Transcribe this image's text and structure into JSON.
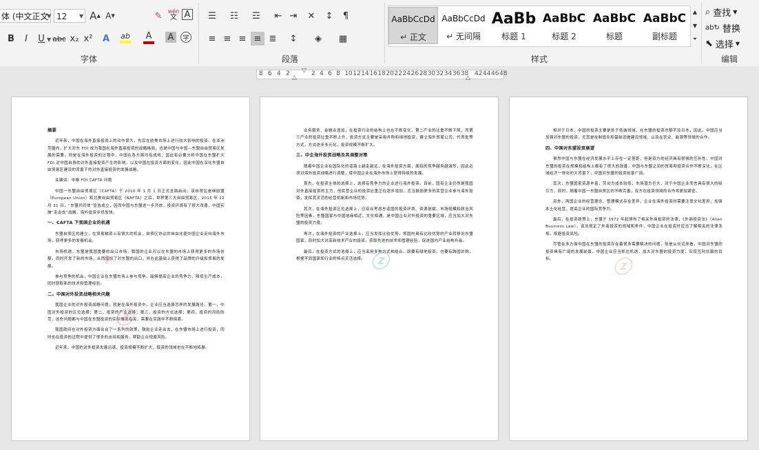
{
  "ribbon": {
    "font": {
      "name": "体 (中文正文",
      "size": "12",
      "group_label": "字体",
      "grow": "A",
      "shrink": "A",
      "phonetic_main": "wén",
      "phonetic_sub": "文",
      "border_char": "A",
      "bold": "B",
      "italic": "I",
      "underline": "U",
      "strike": "abc",
      "subscript": "x₂",
      "superscript": "x²",
      "effects": "A",
      "highlight_label": "ab",
      "font_color_label": "A",
      "char_shade": "A",
      "enclose": "字",
      "highlight_color": "#ffff00",
      "font_color": "#c00000"
    },
    "paragraph": {
      "group_label": "段落"
    },
    "styles": {
      "group_label": "样式",
      "items": [
        {
          "preview": "AaBbCcDd",
          "name": "↵ 正文"
        },
        {
          "preview": "AaBbCcDd",
          "name": "↵ 无间隔"
        },
        {
          "preview": "AaBb",
          "name": "标题 1"
        },
        {
          "preview": "AaBbC",
          "name": "标题 2"
        },
        {
          "preview": "AaBbC",
          "name": "标题"
        },
        {
          "preview": "AaBbC",
          "name": "副标题"
        }
      ]
    },
    "editing": {
      "group_label": "编辑",
      "find": "查找",
      "replace": "替换",
      "select": "选择"
    }
  },
  "ruler": {
    "left_numbers": [
      "8",
      "6",
      "4",
      "2"
    ],
    "numbers": [
      "2",
      "4",
      "6",
      "8",
      "10",
      "12",
      "14",
      "16",
      "18",
      "20",
      "22",
      "24",
      "26",
      "28",
      "30",
      "32",
      "34",
      "36",
      "38"
    ],
    "right_numbers": [
      "42",
      "44",
      "46",
      "48"
    ]
  },
  "pages": [
    {
      "blocks": [
        {
          "type": "head",
          "text": "摘要"
        },
        {
          "type": "para",
          "text": "近年来，中国在海外直接投资上的动作很大，先后在欧美市场上进行较大影响的投资。在亚洲范围内，扩大对东 FDI 成为我国在海外直接投资的战略格局，也是中国与中国—东盟自由贸易区发展的需要。但是在海外投资的过程中，中国在各方面均有成效，因此有必要分析中国在东盟扩大 FDI 对中国自身的对外直接投资产生的影响，以及中国在投资方面的变化，因此中国在深化东盟自由贸易区建设的背景下的对外直接投资的发展战略。"
        },
        {
          "type": "para",
          "text": "关键词：中泰  FDI  CAFTA  问题"
        },
        {
          "type": "para",
          "text": "中国一东盟自由贸易区（CAFTA）于 2010 年 1 月 1 日正式全面启动，该自贸区是继欧盟（European Union）和北美自由贸易区（NAFTA）之后，世界第三大自由贸易区。2015 年 12 月 31 日，“东盟共同体”宣告成立，因而中国与东盟进一步开放，投资环境有了很大改善，中国实施“走出去”战略，海外投资步伐加快。"
        },
        {
          "type": "head",
          "text": "一、CAFTA 下我国企业的机遇"
        },
        {
          "type": "para",
          "text": "东盟自贸区的建立，在贸易融资上有很大的机会，自贸区协议的自由化使中国企业走向海外市场，获得更多的发展机会。"
        },
        {
          "type": "para",
          "text": "市场机遇，东盟是我国重要的出口市场，我国的企业可以在东盟的市场上获得更多的市场份额，同时开发了新的市场，从而增加了对东盟的出口，并在此基础上获得了品牌的升级和贸易的发展。"
        },
        {
          "type": "para",
          "text": "参与竞争的机会，中国企业在东盟市场上参与竞争，能够提高企业的竞争力，降低生产成本，同时获取新的技术和管理经验。"
        },
        {
          "type": "head",
          "text": "二、中国对外投资战略相关问题"
        },
        {
          "type": "para",
          "text": "我国企业的对外投资战略问题，就是在海外投资中，企业应当选择怎样的发展路径。第一，中国对外投资的区位选择；第二，投资的产业选择；第三，投资的方式选择；第四，投资的风险防范，这些问题都与中国在东盟投资的实际情况有关，需要在实践中不断探索。"
        },
        {
          "type": "para",
          "text": "我国政府在对外投资方面出台了一系列的政策，鼓励企业走出去，在东盟市场上进行投资，同时也在投资的过程中提供了很多的支持和服务，帮助企业规避风险。"
        },
        {
          "type": "para",
          "text": "近年来，中国的对外投资发展迅速，投资规模不断扩大，投资的领域也在不断地拓展。"
        }
      ]
    },
    {
      "blocks": [
        {
          "type": "para",
          "text": "业务服务、金融业增加，在投资行业的结构上也在不断变化，第二产业的比重不断下降，而第三产业的投资比重不断上升，投资方式主要是采用并购和绿地投资，建立海外贸易公司、代表处等方式，方式逐步多元化，投资规模不断扩大。"
        },
        {
          "type": "head",
          "text": "三、中企海外投资战略及其调整对策"
        },
        {
          "type": "para",
          "text": "随着中国企业在国际化的道路上越走越远，在海外投资方面，面临的竞争越来越激烈，因此必须对海外投资战略进行调整，使中国企业在海外市场上获得持续的发展。"
        },
        {
          "type": "para",
          "text": "首先，在投资主体的选择上，选择有竞争力的企业进行海外投资。目前，国有企业仍然是我国对外直接投资的主力，但民营企业的投资比重正在逐步增加，应当鼓励更多的民营企业参与海外投资，发挥其灵活的经营机制和市场优势。"
        },
        {
          "type": "para",
          "text": "其次，在海外投资区位选择上，应综合考虑东道国的投资环境、资源禀赋、市场规模和政治风险等因素，东盟国家与中国地缘相近、文化相通，是中国企业对外投资的重要区域，应当加大对东盟的投资力度。"
        },
        {
          "type": "para",
          "text": "再次，在海外投资的产业选择上，应当发挥比较优势，将国内具有比较优势的产业转移到东盟国家，同时加大对高新技术产业的投资，获取先进的技术和管理经验，促进国内产业结构升级。"
        },
        {
          "type": "para",
          "text": "最后，在投资方式的选择上，应当采用多种方式相结合，既要有绿地投资，也要有跨国并购，根据不同国家和行业的特点灵活选择。"
        }
      ]
    },
    {
      "blocks": [
        {
          "type": "para",
          "text": "相对于日本，中国的投资主要是处于低端领域，在东盟的投资总额不及日本，因此，中国应当加强对东盟的投资，尤其是在制造业和基础设施建设领域，以及在农业、能源等领域的合作。"
        },
        {
          "type": "head",
          "text": "四、中国对东盟投资展望"
        },
        {
          "type": "para",
          "text": "虽然中国与东盟在经济发展水平上存在一定差距，但是双方的经济具有很强的互补性，中国对东盟的投资在规模和结构上都有了很大的改善，中国与东盟之间的贸易和投资合作不断深化，在区域经济一体化的大背景下，中国对东盟的投资前景广阔。"
        },
        {
          "type": "para",
          "text": "其次，东盟国家资源丰富，劳动力成本较低，市场潜力巨大，对于中国企业而言具有很大的吸引力，同时，随着中国一东盟自贸区的不断完善，双方在投资领域的合作将更加紧密。"
        },
        {
          "type": "para",
          "text": "另外，两国企业的经营理念、管理模式存在差异，企业在海外投资时需要注意文化差异，加强本土化经营，提高企业的国际竞争力。"
        },
        {
          "type": "para",
          "text": "最后，在投资政策上，东盟于 1972 年起颁布了相关外商投资的法律，《外商投资法》（Alien Business Law），该法规定了外商投资的领域和条件，中国企业在投资时应当了解相关的法律法规，规避投资风险。"
        },
        {
          "type": "para",
          "text": "尽管在多方面中国在东盟的投资存在着很多需要解决的问题，但是从长远来看，中国对东盟的投资具有广阔的发展前景，中国企业应当抓住机遇，加大对东盟的投资力度，实现互利共赢的目标。"
        }
      ]
    }
  ]
}
